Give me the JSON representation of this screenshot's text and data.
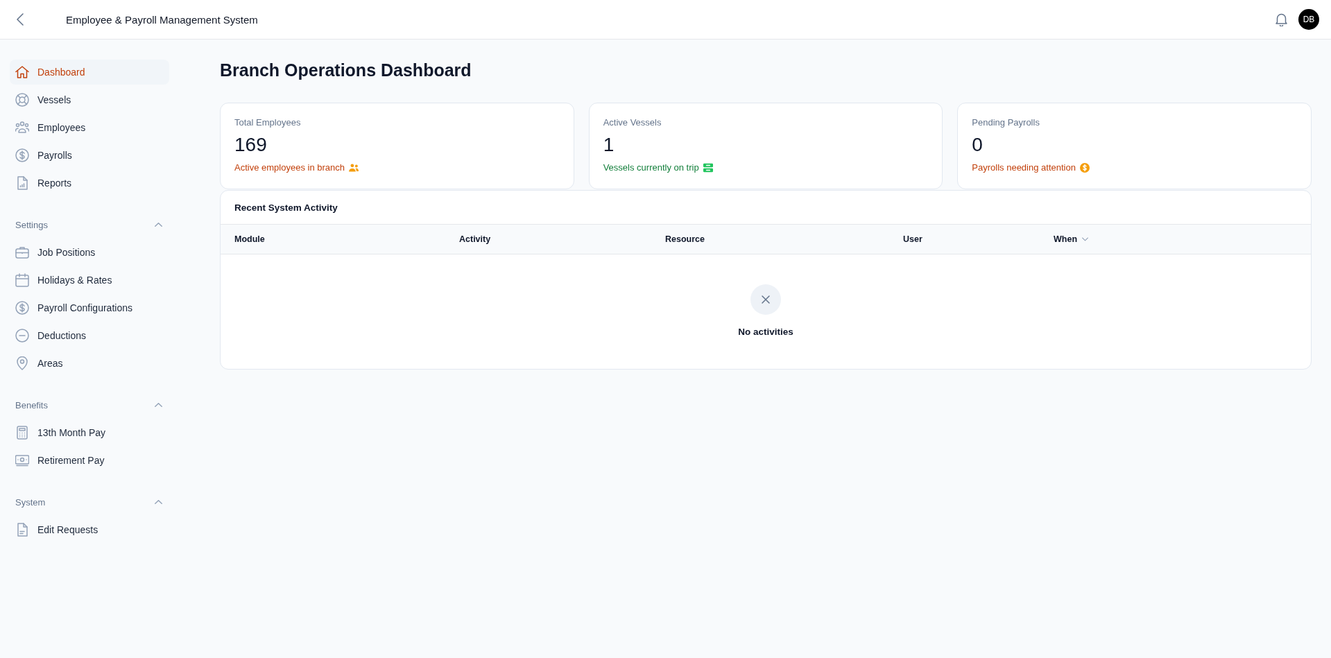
{
  "header": {
    "title": "Employee & Payroll Management System",
    "avatar_initials": "DB"
  },
  "sidebar": {
    "items": [
      {
        "label": "Dashboard",
        "selected": true
      },
      {
        "label": "Vessels",
        "selected": false
      },
      {
        "label": "Employees",
        "selected": false
      },
      {
        "label": "Payrolls",
        "selected": false
      },
      {
        "label": "Reports",
        "selected": false
      }
    ],
    "sections": [
      {
        "title": "Settings",
        "expanded": true,
        "items": [
          {
            "label": "Job Positions",
            "selected": false
          },
          {
            "label": "Holidays & Rates",
            "selected": false
          },
          {
            "label": "Payroll Configurations",
            "selected": false
          },
          {
            "label": "Deductions",
            "selected": false
          },
          {
            "label": "Areas",
            "selected": false
          }
        ]
      },
      {
        "title": "Benefits",
        "expanded": true,
        "items": [
          {
            "label": "13th Month Pay",
            "selected": false
          },
          {
            "label": "Retirement Pay",
            "selected": false
          }
        ]
      },
      {
        "title": "System",
        "expanded": true,
        "items": [
          {
            "label": "Edit Requests",
            "selected": false
          }
        ]
      }
    ]
  },
  "page": {
    "title": "Branch Operations Dashboard"
  },
  "stats": [
    {
      "label": "Total Employees",
      "value": "169",
      "caption": "Active employees in branch",
      "color": "#c2410c"
    },
    {
      "label": "Active Vessels",
      "value": "1",
      "caption": "Vessels currently on trip",
      "color": "#15803d"
    },
    {
      "label": "Pending Payrolls",
      "value": "0",
      "caption": "Payrolls needing attention",
      "color": "#c2410c"
    }
  ],
  "activity": {
    "title": "Recent System Activity",
    "columns": [
      {
        "label": "Module",
        "sorted": false
      },
      {
        "label": "Activity",
        "sorted": false
      },
      {
        "label": "Resource",
        "sorted": false
      },
      {
        "label": "User",
        "sorted": false
      },
      {
        "label": "When",
        "sorted": true
      }
    ],
    "empty_message": "No activities"
  }
}
